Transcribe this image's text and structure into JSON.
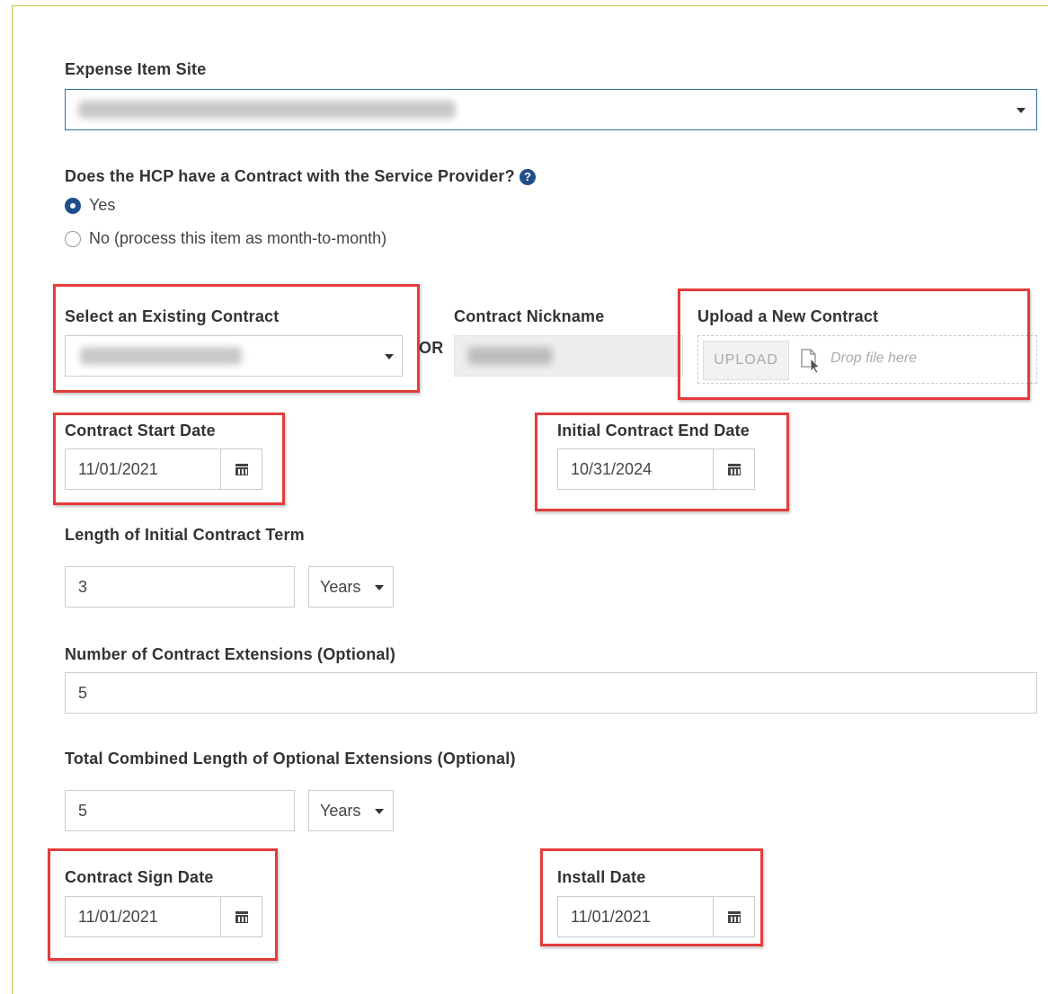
{
  "expense_site": {
    "label": "Expense Item Site"
  },
  "contract_question": {
    "label": "Does the HCP have a Contract with the Service Provider?",
    "help_icon": "question-circle-icon",
    "options": [
      {
        "label": "Yes",
        "selected": true
      },
      {
        "label": "No (process this item as month-to-month)",
        "selected": false
      }
    ]
  },
  "existing_contract": {
    "label": "Select an Existing Contract",
    "or_text": "OR"
  },
  "nickname": {
    "label": "Contract Nickname"
  },
  "upload": {
    "label": "Upload a New Contract",
    "button_label": "UPLOAD",
    "drop_text": "Drop file here",
    "icon": "file-drop-icon"
  },
  "start_date": {
    "label": "Contract Start Date",
    "value": "11/01/2021",
    "icon": "calendar-icon"
  },
  "end_date": {
    "label": "Initial Contract End Date",
    "value": "10/31/2024",
    "icon": "calendar-icon"
  },
  "term": {
    "label": "Length of Initial Contract Term",
    "value": "3",
    "unit": "Years"
  },
  "extensions": {
    "label": "Number of Contract Extensions (Optional)",
    "value": "5"
  },
  "ext_length": {
    "label": "Total Combined Length of Optional Extensions (Optional)",
    "value": "5",
    "unit": "Years"
  },
  "sign_date": {
    "label": "Contract Sign Date",
    "value": "11/01/2021",
    "icon": "calendar-icon"
  },
  "install_date": {
    "label": "Install Date",
    "value": "11/01/2021",
    "icon": "calendar-icon"
  },
  "colors": {
    "highlight": "#e53c3c",
    "radio_selected": "#1f4f8a",
    "frame_border": "#c8c83a"
  }
}
